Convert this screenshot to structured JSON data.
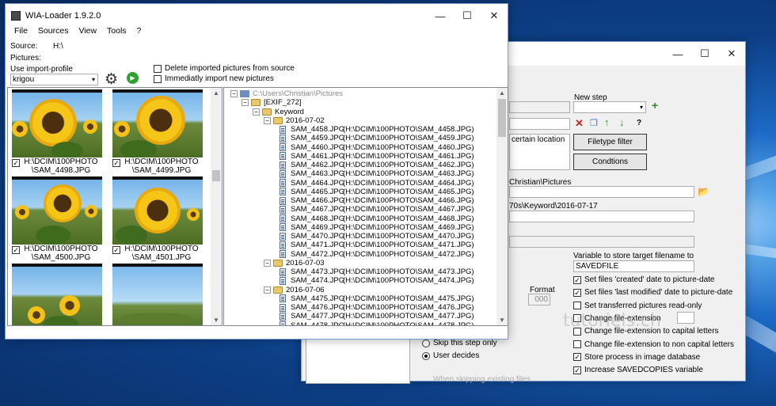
{
  "main": {
    "title": "WIA-Loader 1.9.2.0",
    "menu": [
      "File",
      "Sources",
      "View",
      "Tools",
      "?"
    ],
    "source_label": "Source:",
    "source_value": "H:\\",
    "pictures_label": "Pictures:",
    "profile_label": "Use import-profile",
    "profile_value": "krigou",
    "delete_label": "Delete imported pictures from source",
    "immediate_label": "Immediatly import new pictures",
    "thumbs": [
      {
        "caption": "H:\\DCIM\\100PHOTO\\SAM_4498.JPG",
        "checked": true
      },
      {
        "caption": "H:\\DCIM\\100PHOTO\\SAM_4499.JPG",
        "checked": true
      },
      {
        "caption": "H:\\DCIM\\100PHOTO\\SAM_4500.JPG",
        "checked": true
      },
      {
        "caption": "H:\\DCIM\\100PHOTO\\SAM_4501.JPG",
        "checked": true
      }
    ],
    "tree": {
      "root": "C:\\Users\\Christian\\Pictures",
      "exif": "[EXIF_272]",
      "keyword": "Keyword",
      "groups": [
        {
          "date": "2016-07-02",
          "files": [
            [
              "SAM_4458.JPG",
              "(H:\\DCIM\\100PHOTO\\SAM_4458.JPG)"
            ],
            [
              "SAM_4459.JPG",
              "(H:\\DCIM\\100PHOTO\\SAM_4459.JPG)"
            ],
            [
              "SAM_4460.JPG",
              "(H:\\DCIM\\100PHOTO\\SAM_4460.JPG)"
            ],
            [
              "SAM_4461.JPG",
              "(H:\\DCIM\\100PHOTO\\SAM_4461.JPG)"
            ],
            [
              "SAM_4462.JPG",
              "(H:\\DCIM\\100PHOTO\\SAM_4462.JPG)"
            ],
            [
              "SAM_4463.JPG",
              "(H:\\DCIM\\100PHOTO\\SAM_4463.JPG)"
            ],
            [
              "SAM_4464.JPG",
              "(H:\\DCIM\\100PHOTO\\SAM_4464.JPG)"
            ],
            [
              "SAM_4465.JPG",
              "(H:\\DCIM\\100PHOTO\\SAM_4465.JPG)"
            ],
            [
              "SAM_4466.JPG",
              "(H:\\DCIM\\100PHOTO\\SAM_4466.JPG)"
            ],
            [
              "SAM_4467.JPG",
              "(H:\\DCIM\\100PHOTO\\SAM_4467.JPG)"
            ],
            [
              "SAM_4468.JPG",
              "(H:\\DCIM\\100PHOTO\\SAM_4468.JPG)"
            ],
            [
              "SAM_4469.JPG",
              "(H:\\DCIM\\100PHOTO\\SAM_4469.JPG)"
            ],
            [
              "SAM_4470.JPG",
              "(H:\\DCIM\\100PHOTO\\SAM_4470.JPG)"
            ],
            [
              "SAM_4471.JPG",
              "(H:\\DCIM\\100PHOTO\\SAM_4471.JPG)"
            ],
            [
              "SAM_4472.JPG",
              "(H:\\DCIM\\100PHOTO\\SAM_4472.JPG)"
            ]
          ]
        },
        {
          "date": "2016-07-03",
          "files": [
            [
              "SAM_4473.JPG",
              "(H:\\DCIM\\100PHOTO\\SAM_4473.JPG)"
            ],
            [
              "SAM_4474.JPG",
              "(H:\\DCIM\\100PHOTO\\SAM_4474.JPG)"
            ]
          ]
        },
        {
          "date": "2016-07-06",
          "files": [
            [
              "SAM_4475.JPG",
              "(H:\\DCIM\\100PHOTO\\SAM_4475.JPG)"
            ],
            [
              "SAM_4476.JPG",
              "(H:\\DCIM\\100PHOTO\\SAM_4476.JPG)"
            ],
            [
              "SAM_4477.JPG",
              "(H:\\DCIM\\100PHOTO\\SAM_4477.JPG)"
            ],
            [
              "SAM_4478.JPG",
              "(H:\\DCIM\\100PHOTO\\SAM_4478.JPG)"
            ]
          ]
        }
      ]
    }
  },
  "back": {
    "new_step_label": "New step",
    "location_text": "certain location",
    "filetype_button": "Filetype filter",
    "conditions_button": "Condtions",
    "path1": "Christian\\Pictures",
    "path2": "70s\\Keyword\\2016-07-17",
    "format_label": "Format",
    "format_value": "000",
    "var_label": "Variable to store target filename to",
    "var_value": "SAVEDFILE",
    "options": [
      {
        "label": "Set files 'created' date to picture-date",
        "checked": true
      },
      {
        "label": "Set files 'last modified' date to picture-date",
        "checked": true
      },
      {
        "label": "Set transferred pictures read-only",
        "checked": false
      },
      {
        "label": "Change file-extension",
        "checked": false
      },
      {
        "label": "Change file-extension to capital letters",
        "checked": false
      },
      {
        "label": "Change file-extension to non capital letters",
        "checked": false
      },
      {
        "label": "Store process in image database",
        "checked": true
      },
      {
        "label": "Increase SAVEDCOPIES variable",
        "checked": true
      }
    ],
    "skip_label": "Skip this step only",
    "user_decides_label": "User decides",
    "skipping_label": "When skipping existing files",
    "help": "?"
  },
  "watermark": "tutoriels.ch",
  "colors": {
    "accent": "#2a8a2a",
    "delete": "#cc2222"
  }
}
